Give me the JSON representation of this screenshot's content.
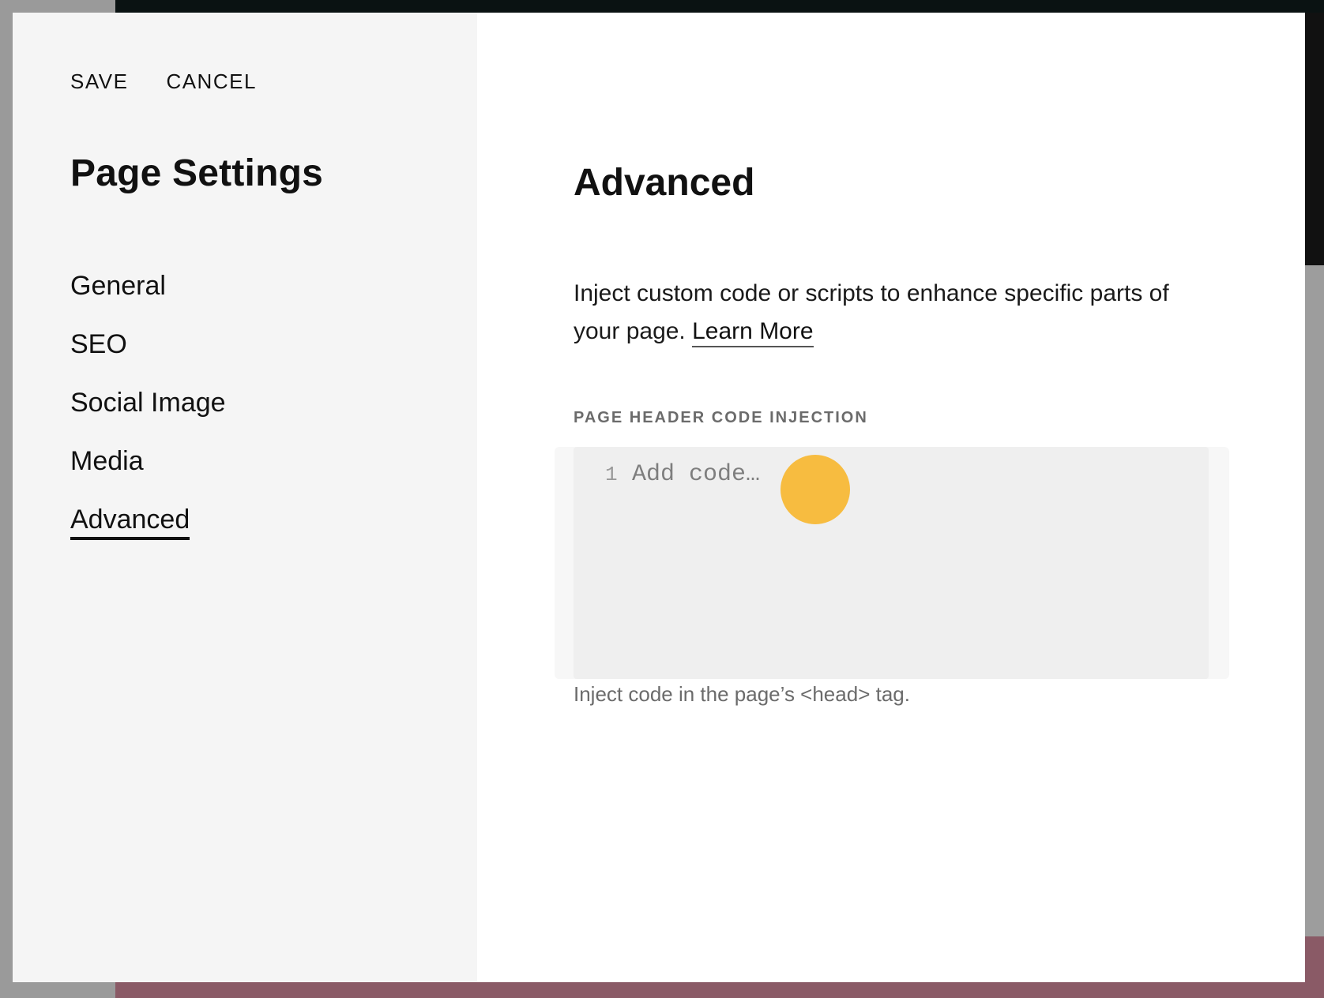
{
  "actions": {
    "save_label": "SAVE",
    "cancel_label": "CANCEL"
  },
  "sidebar": {
    "title": "Page Settings",
    "items": [
      {
        "label": "General",
        "active": false
      },
      {
        "label": "SEO",
        "active": false
      },
      {
        "label": "Social Image",
        "active": false
      },
      {
        "label": "Media",
        "active": false
      },
      {
        "label": "Advanced",
        "active": true
      }
    ]
  },
  "content": {
    "title": "Advanced",
    "description": "Inject custom code or scripts to enhance specific parts of your page.",
    "learn_more": "Learn More",
    "field_label": "PAGE HEADER CODE INJECTION",
    "editor": {
      "line_number": "1",
      "placeholder": "Add code…"
    },
    "help_text": "Inject code in the page’s <head> tag."
  },
  "colors": {
    "accent_dot": "#f7b731",
    "sidebar_bg": "#f5f5f5",
    "editor_bg": "#efefef"
  }
}
